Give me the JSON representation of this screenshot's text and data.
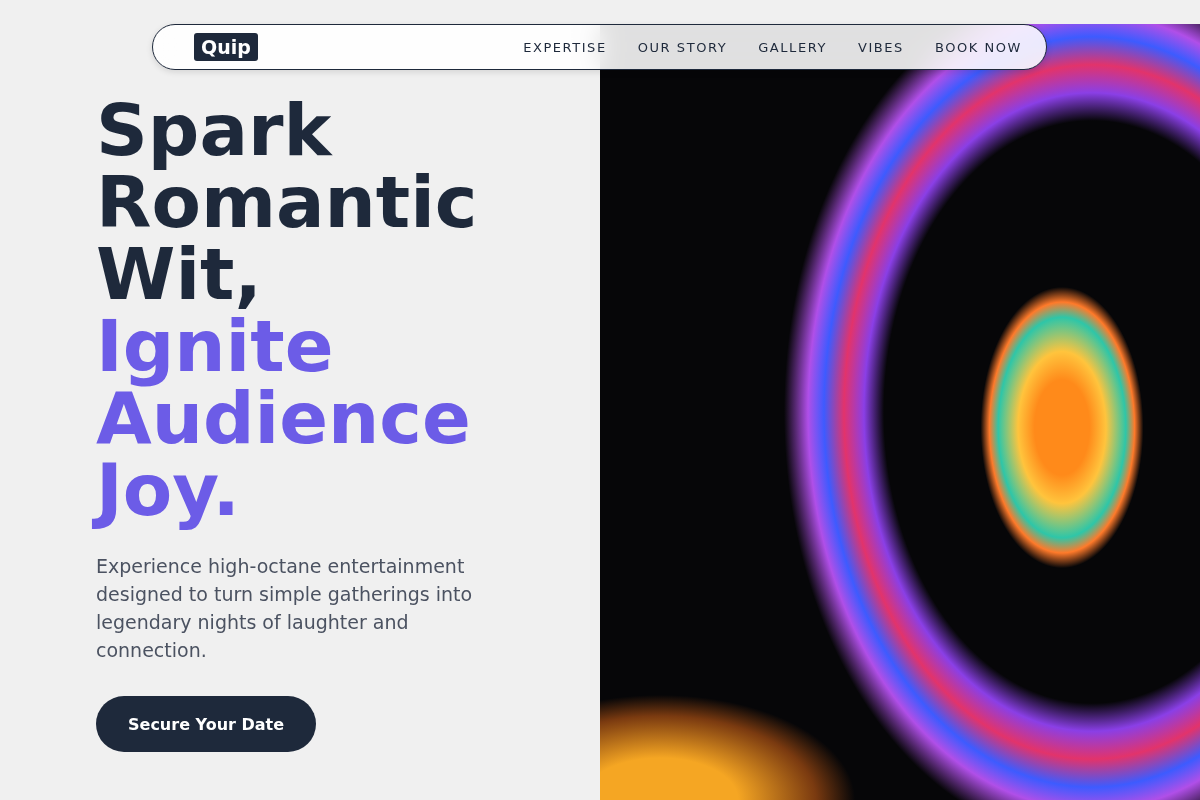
{
  "nav": {
    "logo": "Quip",
    "links": [
      "EXPERTISE",
      "OUR STORY",
      "GALLERY",
      "VIBES",
      "BOOK NOW"
    ]
  },
  "hero": {
    "headline": {
      "lead": "Spark Romantic Wit,",
      "accent": "Ignite Audience Joy."
    },
    "description": "Experience high-octane entertainment designed to turn simple gatherings into legendary nights of laughter and connection.",
    "cta": "Secure Your Date"
  }
}
